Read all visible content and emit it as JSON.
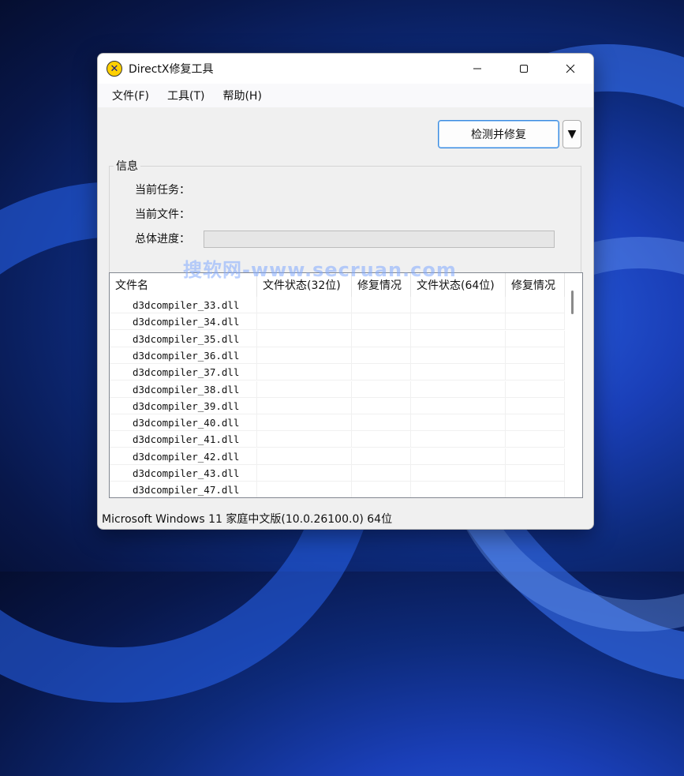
{
  "watermark": "搜软网-www.secruan.com",
  "window": {
    "title": "DirectX修复工具",
    "icon": "directx-x-icon",
    "controls": [
      "minimize-icon",
      "maximize-icon",
      "close-icon"
    ]
  },
  "menu": {
    "items": [
      "文件(F)",
      "工具(T)",
      "帮助(H)"
    ]
  },
  "toolbar": {
    "primary_button": "检测并修复",
    "dropdown_button": "▼"
  },
  "info": {
    "group_title": "信息",
    "current_task_label": "当前任务：",
    "current_file_label": "当前文件：",
    "overall_progress_label": "总体进度：",
    "progress_value": 0
  },
  "table": {
    "columns": [
      "文件名",
      "文件状态(32位)",
      "修复情况",
      "文件状态(64位)",
      "修复情况"
    ],
    "rows": [
      {
        "name": "d3dcompiler_33.dll",
        "status32": "",
        "fix32": "",
        "status64": "",
        "fix64": ""
      },
      {
        "name": "d3dcompiler_34.dll",
        "status32": "",
        "fix32": "",
        "status64": "",
        "fix64": ""
      },
      {
        "name": "d3dcompiler_35.dll",
        "status32": "",
        "fix32": "",
        "status64": "",
        "fix64": ""
      },
      {
        "name": "d3dcompiler_36.dll",
        "status32": "",
        "fix32": "",
        "status64": "",
        "fix64": ""
      },
      {
        "name": "d3dcompiler_37.dll",
        "status32": "",
        "fix32": "",
        "status64": "",
        "fix64": ""
      },
      {
        "name": "d3dcompiler_38.dll",
        "status32": "",
        "fix32": "",
        "status64": "",
        "fix64": ""
      },
      {
        "name": "d3dcompiler_39.dll",
        "status32": "",
        "fix32": "",
        "status64": "",
        "fix64": ""
      },
      {
        "name": "d3dcompiler_40.dll",
        "status32": "",
        "fix32": "",
        "status64": "",
        "fix64": ""
      },
      {
        "name": "d3dcompiler_41.dll",
        "status32": "",
        "fix32": "",
        "status64": "",
        "fix64": ""
      },
      {
        "name": "d3dcompiler_42.dll",
        "status32": "",
        "fix32": "",
        "status64": "",
        "fix64": ""
      },
      {
        "name": "d3dcompiler_43.dll",
        "status32": "",
        "fix32": "",
        "status64": "",
        "fix64": ""
      },
      {
        "name": "d3dcompiler_47.dll",
        "status32": "",
        "fix32": "",
        "status64": "",
        "fix64": ""
      }
    ]
  },
  "statusbar": {
    "text": "Microsoft Windows 11 家庭中文版(10.0.26100.0) 64位"
  }
}
